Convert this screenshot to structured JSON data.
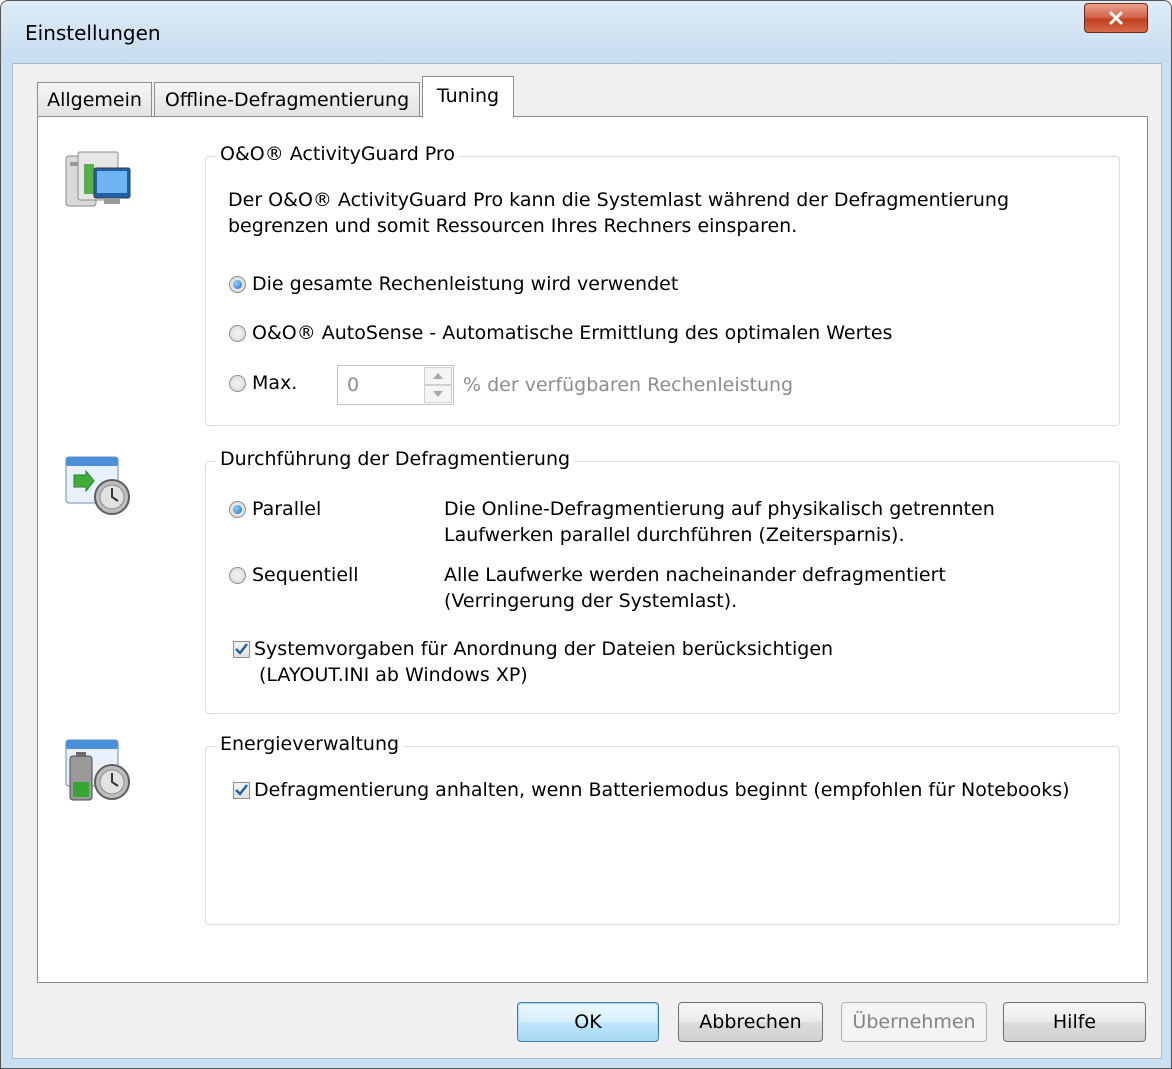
{
  "window": {
    "title": "Einstellungen"
  },
  "tabs": [
    {
      "label": "Allgemein"
    },
    {
      "label": "Offline-Defragmentierung"
    },
    {
      "label": "Tuning"
    }
  ],
  "activity_guard": {
    "title": "O&O® ActivityGuard Pro",
    "description_line1": "Der O&O® ActivityGuard Pro kann die Systemlast während der Defragmentierung",
    "description_line2": "begrenzen und somit Ressourcen Ihres Rechners einsparen.",
    "option_full": "Die gesamte Rechenleistung wird verwendet",
    "option_autosense": "O&O® AutoSense - Automatische Ermittlung des optimalen Wertes",
    "option_max": "Max.",
    "max_value": "0",
    "max_suffix": "% der verfügbaren Rechenleistung",
    "selected": "option_full"
  },
  "execution": {
    "title": "Durchführung der Defragmentierung",
    "parallel_label": "Parallel",
    "parallel_desc_line1": "Die Online-Defragmentierung auf physikalisch getrennten",
    "parallel_desc_line2": "Laufwerken parallel durchführen (Zeitersparnis).",
    "sequential_label": "Sequentiell",
    "sequential_desc_line1": "Alle Laufwerke werden nacheinander defragmentiert",
    "sequential_desc_line2": "(Verringerung der Systemlast).",
    "selected": "parallel",
    "layout_check_line1": "Systemvorgaben für Anordnung der Dateien berücksichtigen",
    "layout_check_line2": "(LAYOUT.INI ab Windows XP)",
    "layout_checked": true
  },
  "energy": {
    "title": "Energieverwaltung",
    "battery_check": "Defragmentierung anhalten, wenn Batteriemodus beginnt (empfohlen für Notebooks)",
    "battery_checked": true
  },
  "buttons": {
    "ok": "OK",
    "cancel": "Abbrechen",
    "apply": "Übernehmen",
    "help": "Hilfe"
  }
}
